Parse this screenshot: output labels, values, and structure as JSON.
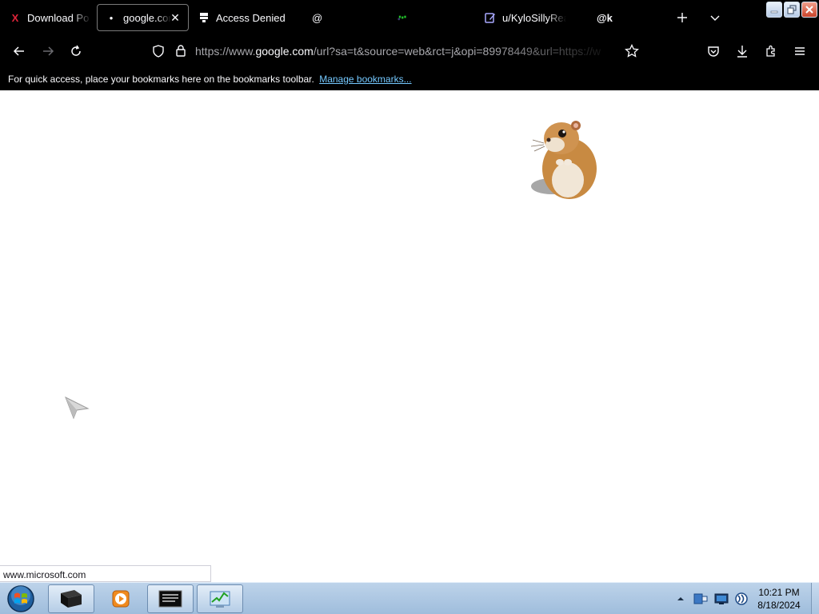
{
  "browser": {
    "tabs": [
      {
        "title": "Download Po",
        "icon": "x-logo-icon",
        "active": false
      },
      {
        "title": "google.con",
        "icon": "dot-icon",
        "active": true
      },
      {
        "title": "Access Denied",
        "icon": "network-icon",
        "active": false
      },
      {
        "title": "@",
        "icon": "",
        "active": false
      },
      {
        "title": "",
        "icon": "green-logo-icon",
        "active": false
      },
      {
        "title": "u/KyloSillyRea",
        "icon": "pen-icon",
        "active": false
      },
      {
        "title": "@k",
        "icon": "",
        "active": false
      }
    ],
    "url": {
      "prefix": "https://www.",
      "host": "google.com",
      "rest": "/url?sa=t&source=web&rct=j&opi=89978449&url=https://w"
    },
    "bookmarks_bar": {
      "message": "For quick access, place your bookmarks here on the bookmarks toolbar.",
      "link": "Manage bookmarks..."
    },
    "status_url": "www.microsoft.com"
  },
  "taskbar": {
    "clock_time": "10:21 PM",
    "clock_date": "8/18/2024"
  },
  "colors": {
    "chrome_bg": "#000000",
    "link": "#75c9ff",
    "taskbar": "#a9c4e0"
  }
}
